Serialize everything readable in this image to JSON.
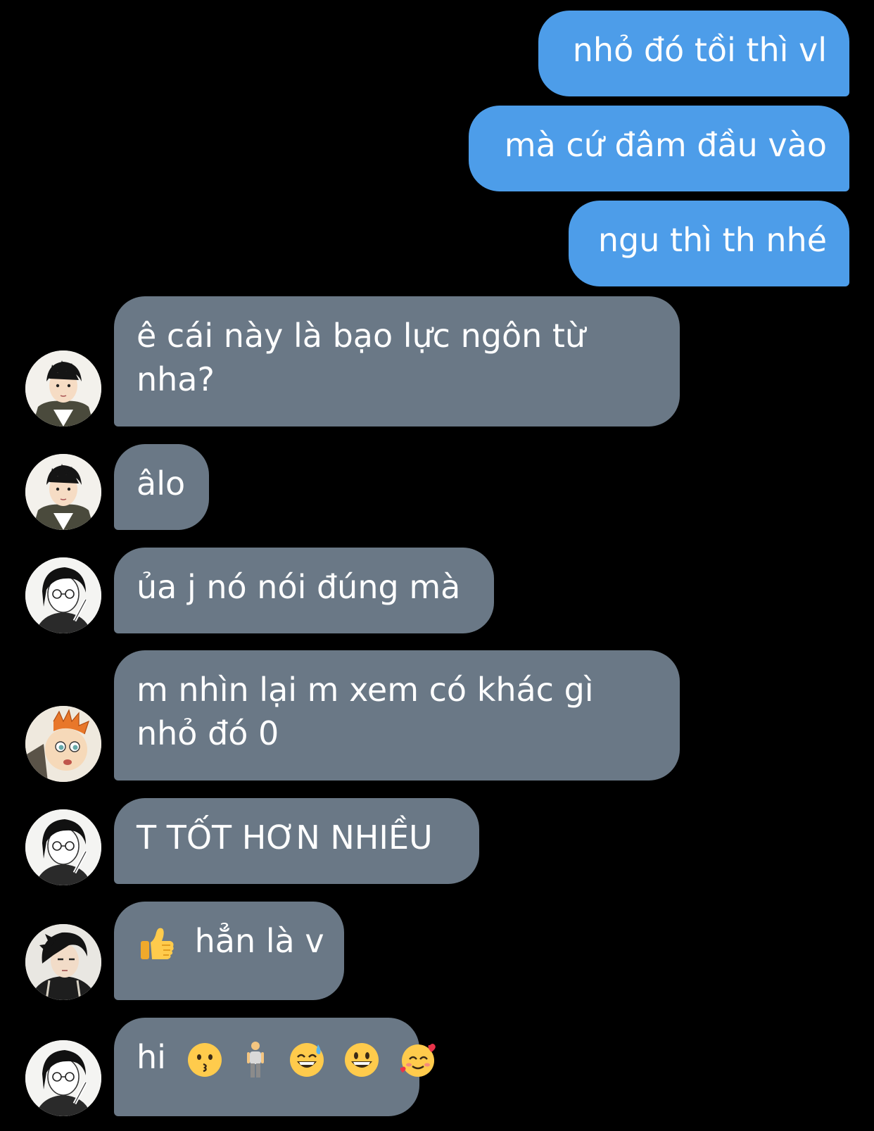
{
  "sent": [
    {
      "text": "nhỏ đó tồi thì vl"
    },
    {
      "text": "mà cứ đâm đầu vào"
    },
    {
      "text": "ngu thì th nhé"
    }
  ],
  "received": [
    {
      "lines": [
        "ê cái này là bạo lực ngôn từ",
        "nha?"
      ],
      "avatar": "avatar-boy-jacket-icon"
    },
    {
      "lines": [
        "âlo"
      ],
      "avatar": "avatar-boy-jacket-icon"
    },
    {
      "lines": [
        "ủa j nó nói đúng mà"
      ],
      "avatar": "avatar-glasses-icon"
    },
    {
      "lines": [
        "m nhìn lại m xem có khác gì",
        "nhỏ đó 0"
      ],
      "avatar": "avatar-orange-hair-icon"
    },
    {
      "lines": [
        "T TỐT HƠN NHIỀU"
      ],
      "avatar": "avatar-glasses-icon"
    },
    {
      "text": "hẳn là v",
      "emoji": "thumbs-up-icon",
      "avatar": "avatar-dark-hair-icon"
    },
    {
      "text": "hi",
      "emojis": [
        "kissing-face-icon",
        "person-standing-icon",
        "grinning-sweat-icon",
        "grinning-face-icon",
        "smiling-hearts-icon"
      ],
      "avatar": "avatar-glasses-icon"
    }
  ],
  "colors": {
    "background": "#000000",
    "sent_bubble": "#4d9de9",
    "received_bubble": "#6a7886",
    "text": "#ffffff"
  }
}
